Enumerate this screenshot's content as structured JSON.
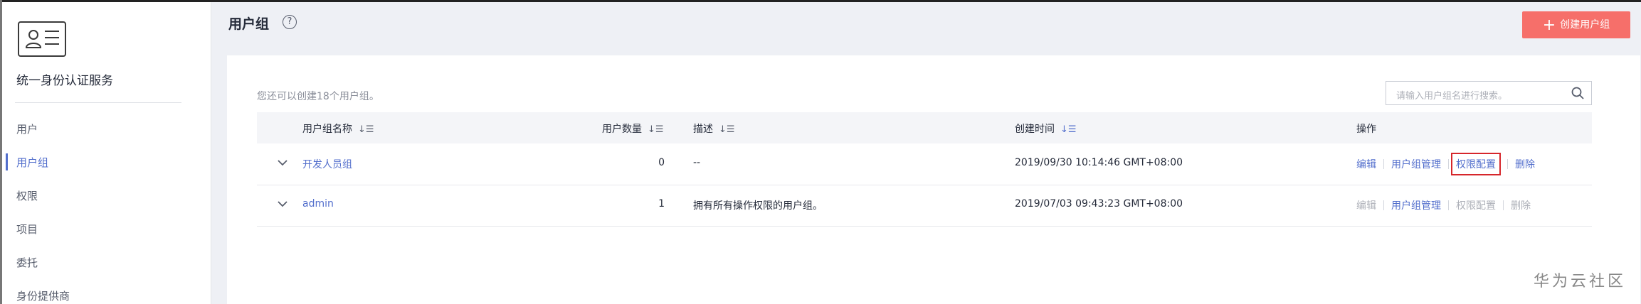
{
  "sidebar": {
    "service_title": "统一身份认证服务",
    "items": [
      {
        "label": "用户"
      },
      {
        "label": "用户组"
      },
      {
        "label": "权限"
      },
      {
        "label": "项目"
      },
      {
        "label": "委托"
      },
      {
        "label": "身份提供商"
      }
    ],
    "active_index": 1
  },
  "header": {
    "title": "用户组",
    "help_icon": "?",
    "create_button": "创建用户组",
    "create_icon": "+"
  },
  "content": {
    "hint": "您还可以创建18个用户组。",
    "search_placeholder": "请输入用户组名进行搜索。"
  },
  "table": {
    "columns": {
      "name": "用户组名称",
      "count": "用户数量",
      "desc": "描述",
      "created": "创建时间",
      "ops": "操作"
    },
    "sort_icon": "↓☰",
    "rows": [
      {
        "name": "开发人员组",
        "count": "0",
        "desc": "--",
        "created": "2019/09/30 10:14:46 GMT+08:00",
        "ops": [
          "编辑",
          "用户组管理",
          "权限配置",
          "删除"
        ]
      },
      {
        "name": "admin",
        "count": "1",
        "desc": "拥有所有操作权限的用户组。",
        "created": "2019/07/03 09:43:23 GMT+08:00",
        "ops": [
          "编辑",
          "用户组管理",
          "权限配置",
          "删除"
        ]
      }
    ]
  },
  "watermark": "华为云社区",
  "colors": {
    "accent": "#526ecc",
    "create_button": "#f66f6a",
    "highlight_box": "#d6262b"
  }
}
